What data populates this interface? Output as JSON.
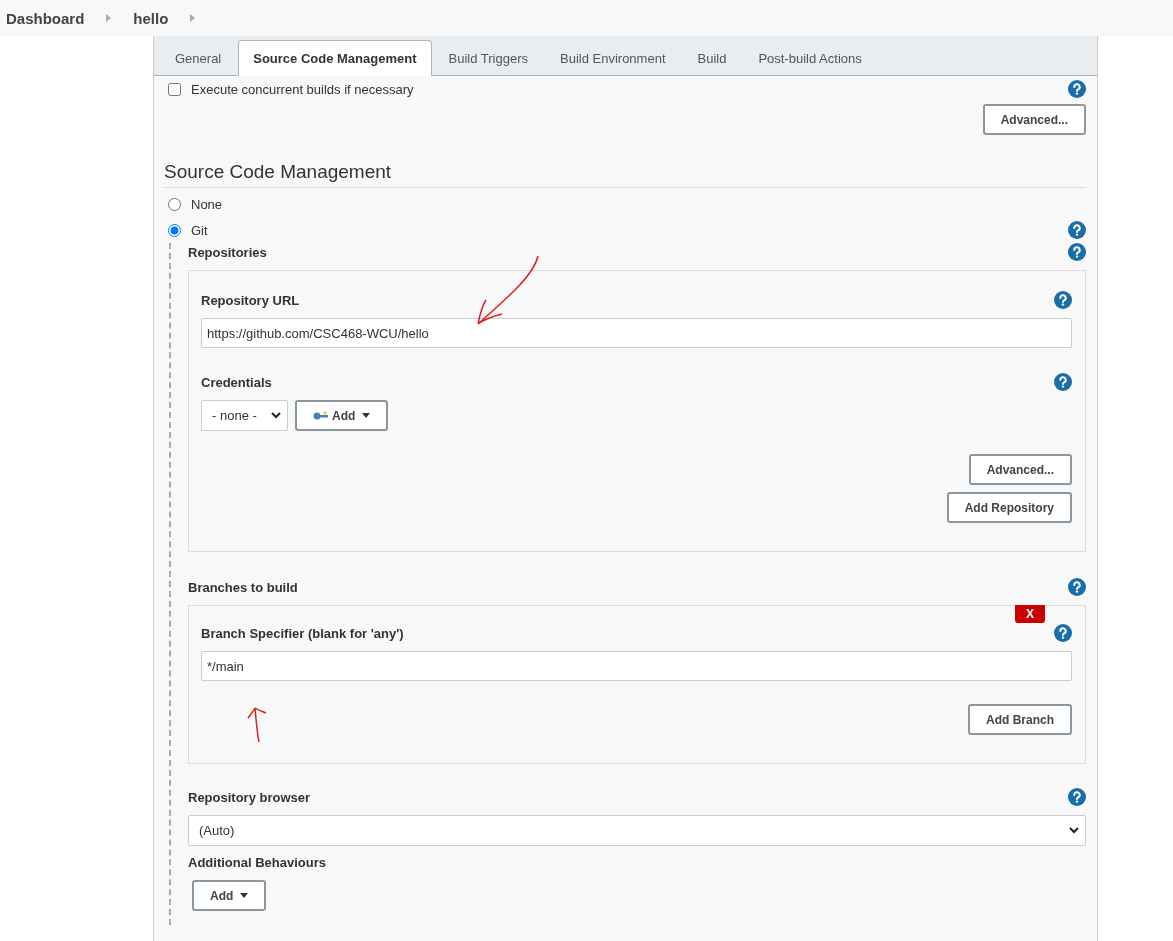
{
  "breadcrumbs": [
    {
      "label": "Dashboard"
    },
    {
      "label": "hello"
    }
  ],
  "tabs": [
    {
      "label": "General",
      "selected": false
    },
    {
      "label": "Source Code Management",
      "selected": true
    },
    {
      "label": "Build Triggers",
      "selected": false
    },
    {
      "label": "Build Environment",
      "selected": false
    },
    {
      "label": "Build",
      "selected": false
    },
    {
      "label": "Post-build Actions",
      "selected": false
    }
  ],
  "concurrent": {
    "label": "Execute concurrent builds if necessary",
    "checked": false
  },
  "advanced_button": "Advanced...",
  "section_title": "Source Code Management",
  "scm_options": [
    {
      "label": "None",
      "selected": false
    },
    {
      "label": "Git",
      "selected": true
    }
  ],
  "repositories": {
    "label": "Repositories",
    "url_label": "Repository URL",
    "url_value": "https://github.com/CSC468-WCU/hello",
    "credentials_label": "Credentials",
    "credentials_value": "- none -",
    "add_button": "Add",
    "advanced_button": "Advanced...",
    "add_repository_button": "Add Repository"
  },
  "branches": {
    "label": "Branches to build",
    "delete_button": "X",
    "specifier_label": "Branch Specifier (blank for 'any')",
    "specifier_value": "*/main",
    "add_branch_button": "Add Branch"
  },
  "repository_browser": {
    "label": "Repository browser",
    "value": "(Auto)"
  },
  "additional_behaviours": {
    "label": "Additional Behaviours",
    "add_button": "Add"
  }
}
